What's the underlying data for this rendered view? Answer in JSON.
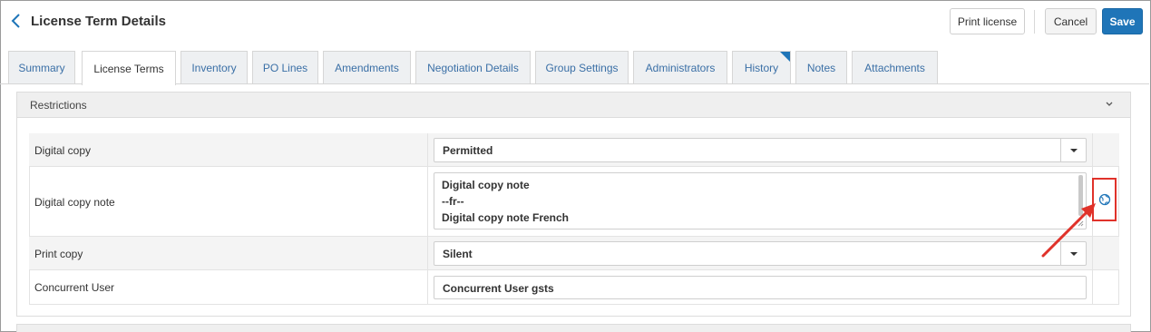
{
  "header": {
    "title": "License Term Details",
    "print_label": "Print license",
    "cancel_label": "Cancel",
    "save_label": "Save"
  },
  "tabs": [
    {
      "label": "Summary",
      "active": false
    },
    {
      "label": "License Terms",
      "active": true
    },
    {
      "label": "Inventory",
      "active": false
    },
    {
      "label": "PO Lines",
      "active": false
    },
    {
      "label": "Amendments",
      "active": false
    },
    {
      "label": "Negotiation Details",
      "active": false
    },
    {
      "label": "Group Settings",
      "active": false
    },
    {
      "label": "Administrators",
      "active": false
    },
    {
      "label": "History",
      "active": false
    },
    {
      "label": "Notes",
      "active": false
    },
    {
      "label": "Attachments",
      "active": false
    }
  ],
  "section": {
    "title": "Restrictions"
  },
  "rows": {
    "digital_copy": {
      "label": "Digital copy",
      "value": "Permitted"
    },
    "digital_copy_note": {
      "label": "Digital copy note",
      "lines": [
        "Digital copy note",
        "--fr--",
        "Digital copy note French"
      ]
    },
    "print_copy": {
      "label": "Print copy",
      "value": "Silent"
    },
    "concurrent_user": {
      "label": "Concurrent User",
      "value": "Concurrent User gsts"
    }
  },
  "icons": {
    "back": "chevron-left-icon",
    "collapse": "chevron-down-icon",
    "translate": "globe-icon",
    "dropdown": "caret-down-icon"
  },
  "colors": {
    "accent": "#1f75b8",
    "highlight": "#e0322a",
    "tab_text": "#3a6fa6"
  }
}
